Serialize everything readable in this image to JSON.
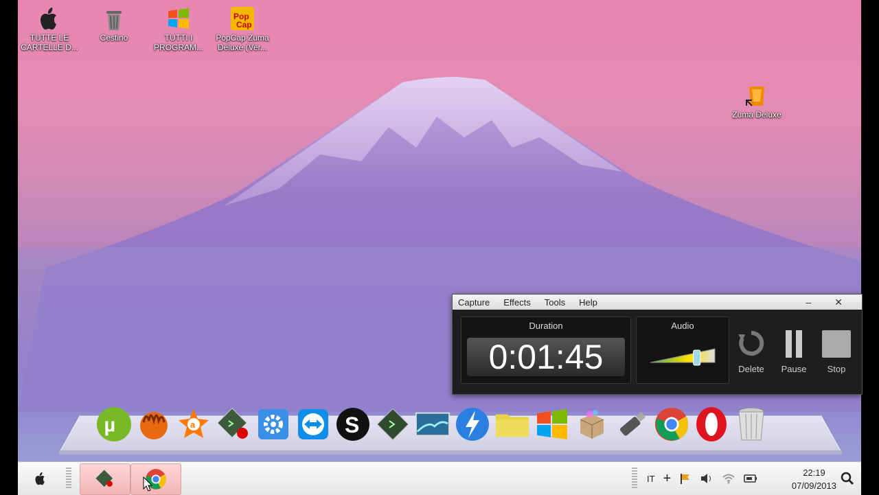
{
  "desktop": {
    "icons": [
      {
        "label": "TUTTE LE\nCARTELLE D...",
        "icon": "apple-icon"
      },
      {
        "label": "Cestino",
        "icon": "trash-icon"
      },
      {
        "label": "TUTTI I\nPROGRAM...",
        "icon": "windows-logo-icon"
      },
      {
        "label": "PopCap Zuma\nDeluxe (Ver...",
        "icon": "popcap-icon"
      },
      {
        "label": "Zuma Deluxe",
        "icon": "zuma-icon"
      }
    ]
  },
  "recorder": {
    "menu": [
      "Capture",
      "Effects",
      "Tools",
      "Help"
    ],
    "minimize": "–",
    "close": "✕",
    "duration_label": "Duration",
    "duration_value": "0:01:45",
    "audio_label": "Audio",
    "audio_level": 0.72,
    "buttons": {
      "delete": "Delete",
      "pause": "Pause",
      "stop": "Stop"
    }
  },
  "dock": {
    "icons": [
      "utorrent-icon",
      "hand-icon",
      "avast-icon",
      "camstudio-icon",
      "settings-icon",
      "teamviewer-icon",
      "skype-icon",
      "camtasia-icon",
      "gallery-icon",
      "bolt-icon",
      "folder-icon",
      "windows-logo-icon",
      "box-icon",
      "usb-icon",
      "chrome-icon",
      "opera-icon",
      "trash-icon"
    ]
  },
  "taskbar": {
    "language": "IT",
    "time": "22:19",
    "date": "07/09/2013",
    "apps": [
      "recorder-app-icon",
      "chrome-icon"
    ],
    "accent": "#f2b6b6"
  }
}
